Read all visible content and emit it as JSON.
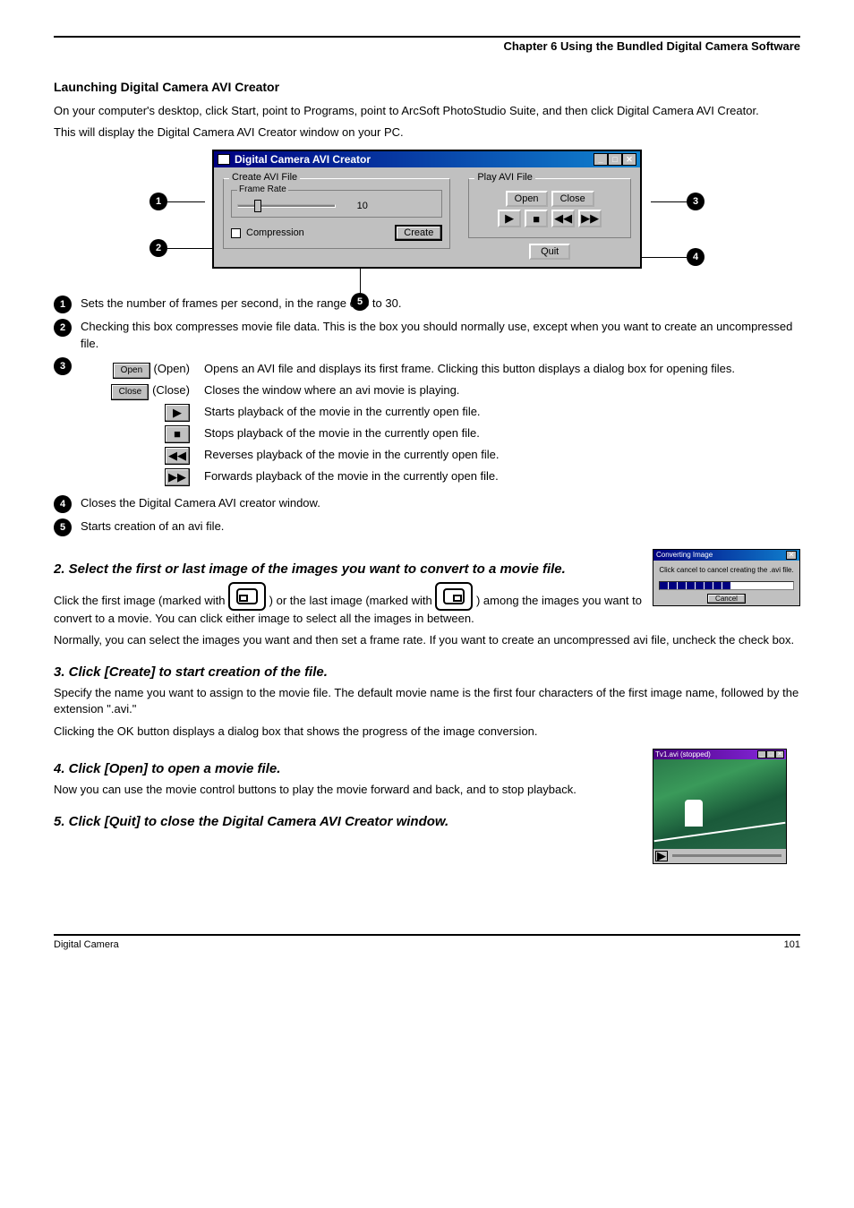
{
  "header": {
    "chapter": "Chapter 6  Using the Bundled Digital Camera Software"
  },
  "intro": {
    "title": "Launching Digital Camera AVI Creator",
    "text1": "On your computer's desktop, click Start, point to Programs, point to ArcSoft PhotoStudio Suite, and then click Digital Camera AVI Creator.",
    "text2": "This will display the Digital Camera AVI Creator window on your PC."
  },
  "dialog": {
    "title": "Digital Camera AVI Creator",
    "create_group": "Create AVI File",
    "frame_rate_group": "Frame Rate",
    "frame_rate_value": "10",
    "compression": "Compression",
    "create_btn": "Create",
    "play_group": "Play AVI File",
    "open_btn": "Open",
    "close_btn": "Close",
    "quit_btn": "Quit"
  },
  "bubbles": {
    "b1": "1",
    "b2": "2",
    "b3": "3",
    "b4": "4",
    "b5": "5"
  },
  "legend": {
    "l1_label": "1",
    "l1_text": "Sets the number of frames per second, in the range of 5 to 30.",
    "l2_label": "2",
    "l2_text": "Checking this box compresses movie file data. This is the box you should normally use, except when you want to create an uncompressed file.",
    "l3_label": "3",
    "l3_lead": "(Open)",
    "l3_open": "Open",
    "l3_open_desc": "Opens an AVI file and displays its first frame.  Clicking this button displays a dialog box for opening files.",
    "l3_close": "Close",
    "l3_close_lead": "(Close)",
    "l3_close_desc": "Closes the window where an avi movie is playing.",
    "l3_play_desc": "Starts playback of the movie in the currently open file.",
    "l3_stop_desc": "Stops playback of the movie in the currently open file.",
    "l3_rew_desc": "Reverses playback of the movie in the currently open file.",
    "l3_ff_desc": "Forwards playback of the movie in the currently open file.",
    "l4_label": "4",
    "l4_text": "Closes the Digital Camera AVI creator window.",
    "l5_label": "5",
    "l5_text": "Starts creation of an avi file."
  },
  "steps": {
    "h2": "2. Select the first or last image of the images you want to convert to a movie file.",
    "p2a": "Click the first image (marked with ) or the last image (marked with ) among the images you want to convert to a movie. You can click either image to select all the images in between.",
    "p2b": "Normally, you can select the images you want and then set a frame rate. If you want to create an uncompressed avi file, uncheck the check box.",
    "h3": "3. Click [Create] to start creation of the file.",
    "p3a": "Specify the name you want to assign to the movie file. The default movie name is the first four characters of the first image name, followed by the extension \".avi.\"",
    "p3b": "Clicking the OK button displays a dialog box that shows the progress of the image conversion.",
    "h4": "4. Click [Open] to open a movie file.",
    "p4": "Now you can use the movie control buttons to play the movie forward and back, and to stop playback.",
    "h5": "5. Click [Quit] to close the Digital Camera AVI Creator window."
  },
  "converting": {
    "title": "Converting Image",
    "msg": "Click cancel to cancel creating the .avi file.",
    "cancel": "Cancel"
  },
  "player": {
    "title": "Tv1.avi (stopped)"
  },
  "footer": {
    "left": "Digital Camera",
    "right": "101"
  }
}
